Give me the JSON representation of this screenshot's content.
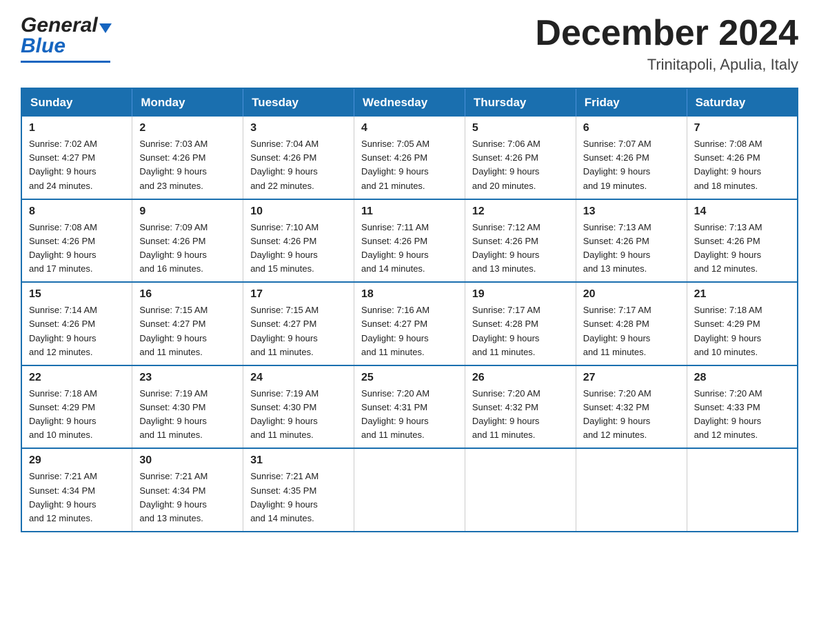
{
  "header": {
    "logo_general": "General",
    "logo_blue": "Blue",
    "month_title": "December 2024",
    "location": "Trinitapoli, Apulia, Italy"
  },
  "days_of_week": [
    "Sunday",
    "Monday",
    "Tuesday",
    "Wednesday",
    "Thursday",
    "Friday",
    "Saturday"
  ],
  "weeks": [
    [
      {
        "day": "1",
        "sunrise": "7:02 AM",
        "sunset": "4:27 PM",
        "daylight": "9 hours and 24 minutes."
      },
      {
        "day": "2",
        "sunrise": "7:03 AM",
        "sunset": "4:26 PM",
        "daylight": "9 hours and 23 minutes."
      },
      {
        "day": "3",
        "sunrise": "7:04 AM",
        "sunset": "4:26 PM",
        "daylight": "9 hours and 22 minutes."
      },
      {
        "day": "4",
        "sunrise": "7:05 AM",
        "sunset": "4:26 PM",
        "daylight": "9 hours and 21 minutes."
      },
      {
        "day": "5",
        "sunrise": "7:06 AM",
        "sunset": "4:26 PM",
        "daylight": "9 hours and 20 minutes."
      },
      {
        "day": "6",
        "sunrise": "7:07 AM",
        "sunset": "4:26 PM",
        "daylight": "9 hours and 19 minutes."
      },
      {
        "day": "7",
        "sunrise": "7:08 AM",
        "sunset": "4:26 PM",
        "daylight": "9 hours and 18 minutes."
      }
    ],
    [
      {
        "day": "8",
        "sunrise": "7:08 AM",
        "sunset": "4:26 PM",
        "daylight": "9 hours and 17 minutes."
      },
      {
        "day": "9",
        "sunrise": "7:09 AM",
        "sunset": "4:26 PM",
        "daylight": "9 hours and 16 minutes."
      },
      {
        "day": "10",
        "sunrise": "7:10 AM",
        "sunset": "4:26 PM",
        "daylight": "9 hours and 15 minutes."
      },
      {
        "day": "11",
        "sunrise": "7:11 AM",
        "sunset": "4:26 PM",
        "daylight": "9 hours and 14 minutes."
      },
      {
        "day": "12",
        "sunrise": "7:12 AM",
        "sunset": "4:26 PM",
        "daylight": "9 hours and 13 minutes."
      },
      {
        "day": "13",
        "sunrise": "7:13 AM",
        "sunset": "4:26 PM",
        "daylight": "9 hours and 13 minutes."
      },
      {
        "day": "14",
        "sunrise": "7:13 AM",
        "sunset": "4:26 PM",
        "daylight": "9 hours and 12 minutes."
      }
    ],
    [
      {
        "day": "15",
        "sunrise": "7:14 AM",
        "sunset": "4:26 PM",
        "daylight": "9 hours and 12 minutes."
      },
      {
        "day": "16",
        "sunrise": "7:15 AM",
        "sunset": "4:27 PM",
        "daylight": "9 hours and 11 minutes."
      },
      {
        "day": "17",
        "sunrise": "7:15 AM",
        "sunset": "4:27 PM",
        "daylight": "9 hours and 11 minutes."
      },
      {
        "day": "18",
        "sunrise": "7:16 AM",
        "sunset": "4:27 PM",
        "daylight": "9 hours and 11 minutes."
      },
      {
        "day": "19",
        "sunrise": "7:17 AM",
        "sunset": "4:28 PM",
        "daylight": "9 hours and 11 minutes."
      },
      {
        "day": "20",
        "sunrise": "7:17 AM",
        "sunset": "4:28 PM",
        "daylight": "9 hours and 11 minutes."
      },
      {
        "day": "21",
        "sunrise": "7:18 AM",
        "sunset": "4:29 PM",
        "daylight": "9 hours and 10 minutes."
      }
    ],
    [
      {
        "day": "22",
        "sunrise": "7:18 AM",
        "sunset": "4:29 PM",
        "daylight": "9 hours and 10 minutes."
      },
      {
        "day": "23",
        "sunrise": "7:19 AM",
        "sunset": "4:30 PM",
        "daylight": "9 hours and 11 minutes."
      },
      {
        "day": "24",
        "sunrise": "7:19 AM",
        "sunset": "4:30 PM",
        "daylight": "9 hours and 11 minutes."
      },
      {
        "day": "25",
        "sunrise": "7:20 AM",
        "sunset": "4:31 PM",
        "daylight": "9 hours and 11 minutes."
      },
      {
        "day": "26",
        "sunrise": "7:20 AM",
        "sunset": "4:32 PM",
        "daylight": "9 hours and 11 minutes."
      },
      {
        "day": "27",
        "sunrise": "7:20 AM",
        "sunset": "4:32 PM",
        "daylight": "9 hours and 12 minutes."
      },
      {
        "day": "28",
        "sunrise": "7:20 AM",
        "sunset": "4:33 PM",
        "daylight": "9 hours and 12 minutes."
      }
    ],
    [
      {
        "day": "29",
        "sunrise": "7:21 AM",
        "sunset": "4:34 PM",
        "daylight": "9 hours and 12 minutes."
      },
      {
        "day": "30",
        "sunrise": "7:21 AM",
        "sunset": "4:34 PM",
        "daylight": "9 hours and 13 minutes."
      },
      {
        "day": "31",
        "sunrise": "7:21 AM",
        "sunset": "4:35 PM",
        "daylight": "9 hours and 14 minutes."
      },
      null,
      null,
      null,
      null
    ]
  ],
  "labels": {
    "sunrise": "Sunrise:",
    "sunset": "Sunset:",
    "daylight": "Daylight:"
  }
}
